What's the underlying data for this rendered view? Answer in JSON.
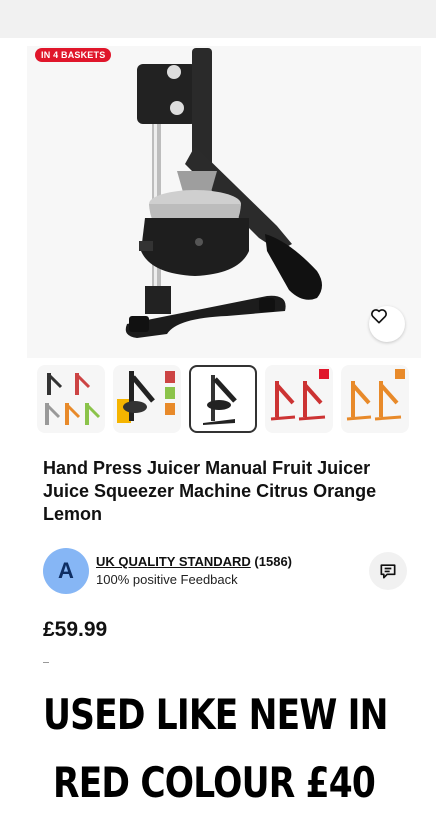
{
  "badge": "IN 4 BASKETS",
  "icons": {
    "favorite": "heart-icon",
    "message": "chat-icon"
  },
  "thumbnails": [
    {
      "name": "thumbnail-1",
      "active": false
    },
    {
      "name": "thumbnail-2",
      "active": false
    },
    {
      "name": "thumbnail-3",
      "active": true
    },
    {
      "name": "thumbnail-4",
      "active": false
    },
    {
      "name": "thumbnail-5",
      "active": false
    }
  ],
  "product": {
    "title": "Hand Press Juicer Manual Fruit Juicer Juice Squeezer Machine Citrus Orange Lemon",
    "price": "£59.99"
  },
  "seller": {
    "avatar_letter": "A",
    "name": "UK QUALITY STANDARD",
    "count": "(1586)",
    "feedback": "100% positive Feedback"
  },
  "caption": {
    "line1": "USED LIKE NEW IN",
    "line2": "RED COLOUR £40"
  },
  "colors": {
    "badge": "#e0162b",
    "avatar": "#86b6f5"
  }
}
